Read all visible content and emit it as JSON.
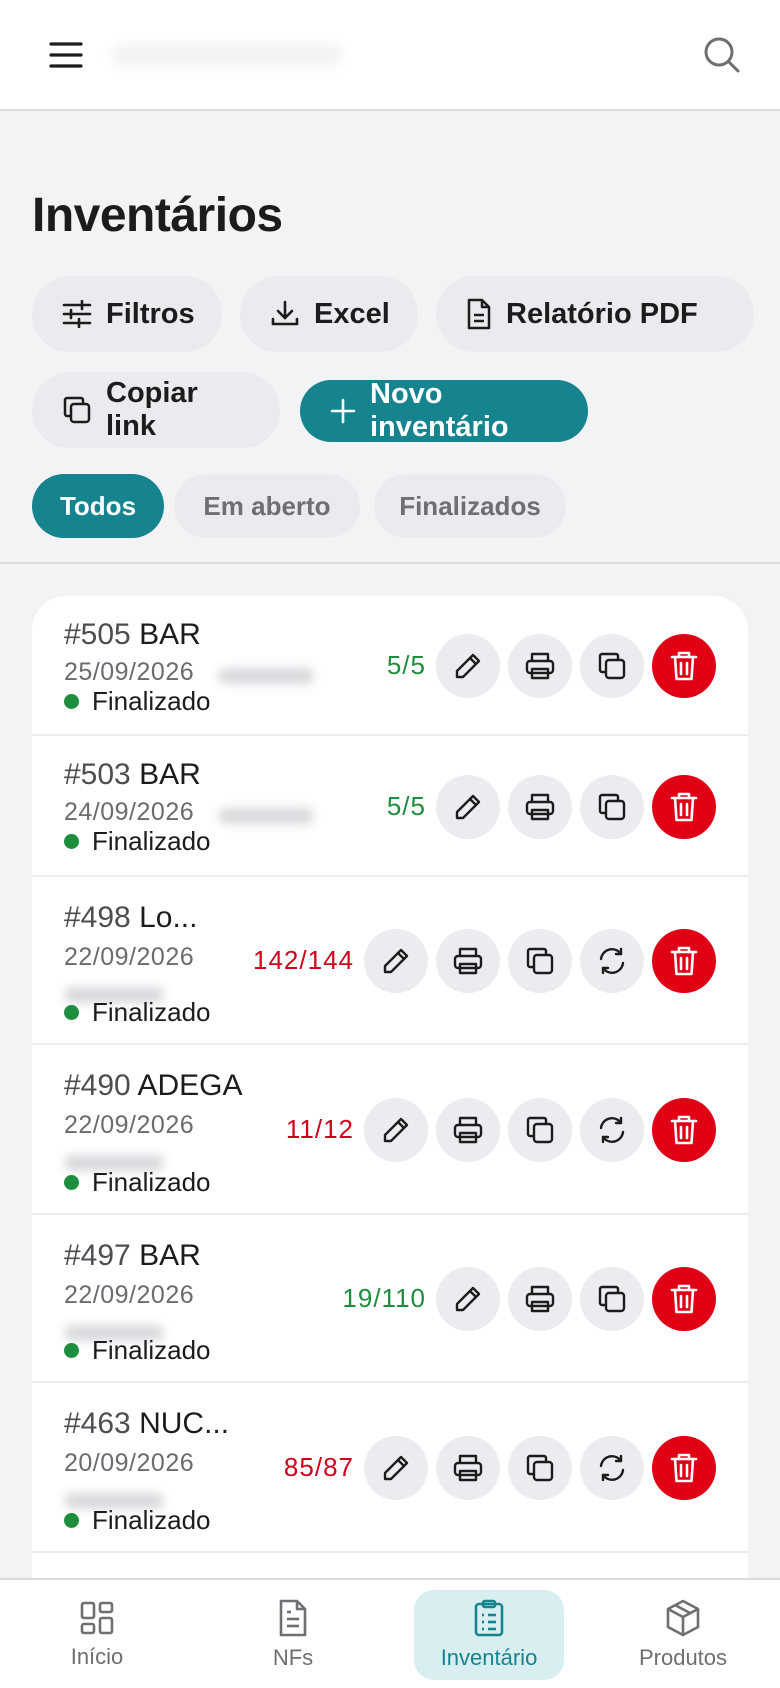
{
  "header": {
    "menu_icon": "menu-icon",
    "search_icon": "search-icon"
  },
  "page": {
    "title": "Inventários"
  },
  "actions": {
    "filters": "Filtros",
    "excel": "Excel",
    "pdf": "Relatório PDF",
    "copy_link": "Copiar link",
    "new": "Novo inventário"
  },
  "tabs": {
    "all": "Todos",
    "open": "Em aberto",
    "done": "Finalizados"
  },
  "items": [
    {
      "num": "#505",
      "name": "BAR",
      "date": "25/09/2026",
      "status": "Finalizado",
      "count": "5/5",
      "count_state": "ok",
      "sync": false
    },
    {
      "num": "#503",
      "name": "BAR",
      "date": "24/09/2026",
      "status": "Finalizado",
      "count": "5/5",
      "count_state": "ok",
      "sync": false
    },
    {
      "num": "#498",
      "name": "Lo...",
      "date": "22/09/2026",
      "status": "Finalizado",
      "count": "142/144",
      "count_state": "bad",
      "sync": true
    },
    {
      "num": "#490",
      "name": "ADEGA",
      "date": "22/09/2026",
      "status": "Finalizado",
      "count": "11/12",
      "count_state": "bad",
      "sync": true
    },
    {
      "num": "#497",
      "name": "BAR",
      "date": "22/09/2026",
      "status": "Finalizado",
      "count": "19/110",
      "count_state": "ok",
      "sync": false
    },
    {
      "num": "#463",
      "name": "NUC...",
      "date": "20/09/2026",
      "status": "Finalizado",
      "count": "85/87",
      "count_state": "bad",
      "sync": true
    }
  ],
  "nav": {
    "home": "Início",
    "nfs": "NFs",
    "inventory": "Inventário",
    "products": "Produtos"
  },
  "colors": {
    "accent": "#15848f",
    "danger": "#e00016",
    "ok": "#1e8e3e",
    "bad": "#d0021b"
  }
}
